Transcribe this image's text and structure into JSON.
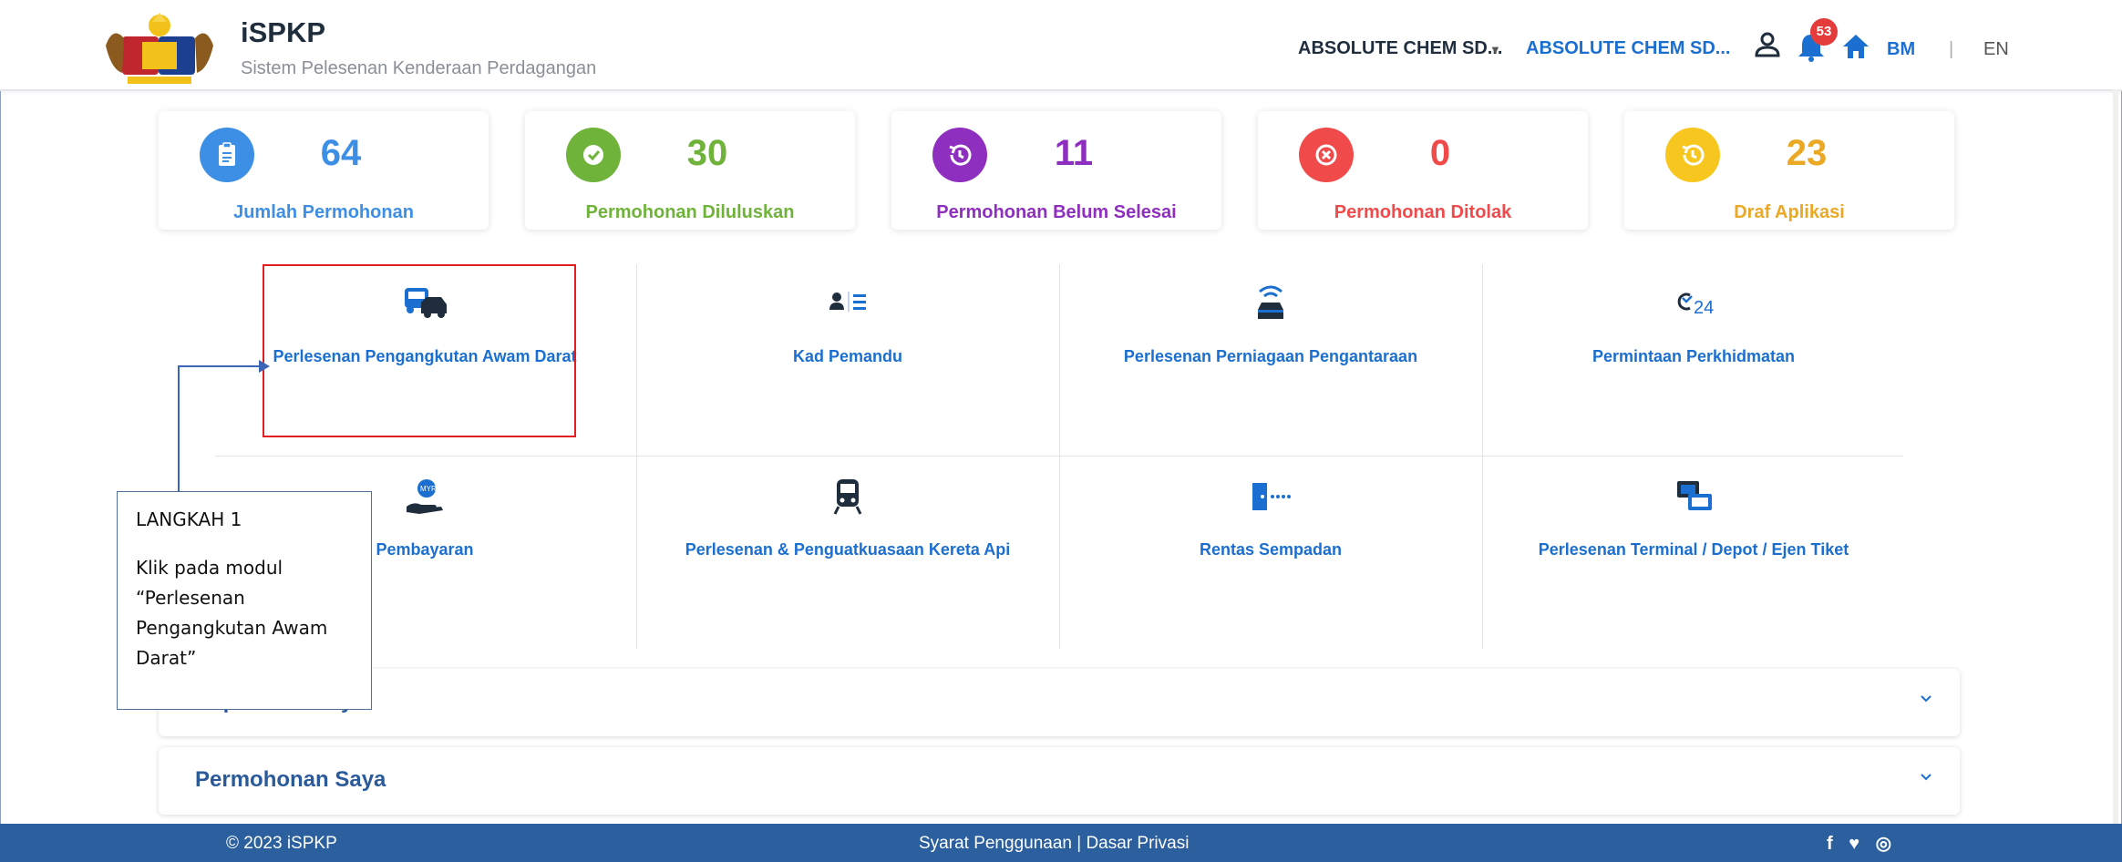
{
  "header": {
    "app_title": "iSPKP",
    "app_subtitle": "Sistem Pelesenan Kenderaan Perdagangan",
    "org_select": "ABSOLUTE CHEM SD...",
    "org_link": "ABSOLUTE CHEM SD...",
    "notification_count": "53",
    "lang_bm": "BM",
    "lang_separator": "|",
    "lang_en": "EN",
    "icons": [
      "crest-logo",
      "user-icon",
      "bell-icon",
      "home-icon"
    ]
  },
  "stats": [
    {
      "value": "64",
      "label": "Jumlah Permohonan",
      "color": "#3d8fe6",
      "icon": "clipboard-icon"
    },
    {
      "value": "30",
      "label": "Permohonan Diluluskan",
      "color": "#6fb33a",
      "icon": "check-icon"
    },
    {
      "value": "11",
      "label": "Permohonan Belum Selesai",
      "color": "#8e2fbf",
      "icon": "history-icon"
    },
    {
      "value": "0",
      "label": "Permohonan Ditolak",
      "color": "#f04a4a",
      "icon": "x-circle-icon"
    },
    {
      "value": "23",
      "label": "Draf Aplikasi",
      "color": "#eaa825",
      "icon": "history-icon"
    }
  ],
  "modules": [
    {
      "label": "Perlesenan Pengangkutan Awam Darat",
      "icon": "bus-car-icon"
    },
    {
      "label": "Kad Pemandu",
      "icon": "driver-card-icon"
    },
    {
      "label": "Perlesenan Perniagaan Pengantaraan",
      "icon": "connected-car-icon"
    },
    {
      "label": "Permintaan Perkhidmatan",
      "icon": "service-24-icon"
    },
    {
      "label": "Pembayaran",
      "icon": "payment-hand-icon"
    },
    {
      "label": "Perlesenan & Penguatkuasaan Kereta Api",
      "icon": "train-icon"
    },
    {
      "label": "Rentas Sempadan",
      "icon": "border-gate-icon"
    },
    {
      "label": "Perlesenan Terminal / Depot / Ejen Tiket",
      "icon": "ticket-icon"
    }
  ],
  "accordions": [
    {
      "title": "Keputusan Saya"
    },
    {
      "title": "Permohonan Saya"
    }
  ],
  "callout": {
    "step": "LANGKAH 1",
    "line1": "Klik pada modul",
    "line2": "“Perlesenan",
    "line3": "Pengangkutan Awam",
    "line4": "Darat”"
  },
  "footer": {
    "copyright": "© 2023 iSPKP",
    "links": "Syarat Penggunaan | Dasar Privasi",
    "social": "f ♥ ◎"
  },
  "colors": {
    "primary": "#1a6fd0",
    "footer": "#2b5f9e",
    "highlight": "#e02020"
  }
}
